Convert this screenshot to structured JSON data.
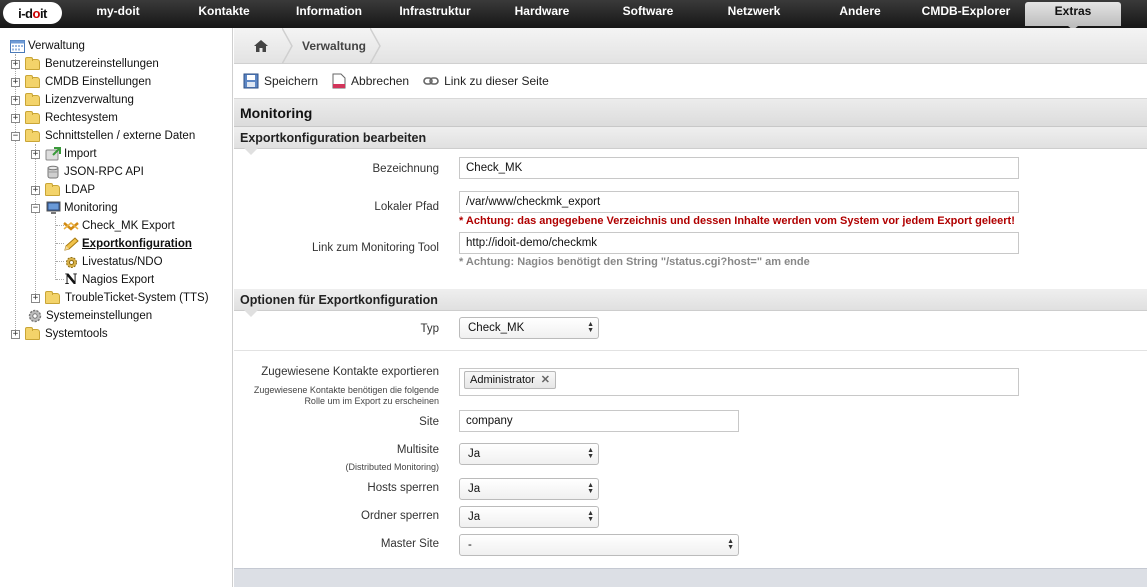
{
  "logo": {
    "part1": "i-d",
    "dot": "o",
    "part2": "it"
  },
  "nav": [
    "my-doit",
    "Kontakte",
    "Information",
    "Infrastruktur",
    "Hardware",
    "Software",
    "Netzwerk",
    "Andere",
    "CMDB-Explorer",
    "Extras"
  ],
  "nav_active": "Extras",
  "tree": {
    "root": "Verwaltung",
    "items": [
      "Benutzereinstellungen",
      "CMDB Einstellungen",
      "Lizenzverwaltung",
      "Rechtesystem",
      "Schnittstellen / externe Daten",
      "Import",
      "JSON-RPC API",
      "LDAP",
      "Monitoring",
      "Check_MK Export",
      "Exportkonfiguration",
      "Livestatus/NDO",
      "Nagios Export",
      "TroubleTicket-System (TTS)",
      "Systemeinstellungen",
      "Systemtools"
    ]
  },
  "breadcrumb": {
    "label": "Verwaltung"
  },
  "toolbar": {
    "save": "Speichern",
    "cancel": "Abbrechen",
    "link": "Link zu dieser Seite"
  },
  "page_title": "Monitoring",
  "section1": {
    "title": "Exportkonfiguration bearbeiten",
    "bezeichnung_label": "Bezeichnung",
    "bezeichnung_value": "Check_MK",
    "pfad_label": "Lokaler Pfad",
    "pfad_value": "/var/www/checkmk_export",
    "pfad_warning": "* Achtung: das angegebene Verzeichnis und dessen Inhalte werden vom System vor jedem Export geleert!",
    "link_label": "Link zum Monitoring Tool",
    "link_value": "http://idoit-demo/checkmk",
    "link_hint": "* Achtung: Nagios benötigt den String \"/status.cgi?host=\" am ende"
  },
  "section2": {
    "title": "Optionen für Exportkonfiguration",
    "typ_label": "Typ",
    "typ_value": "Check_MK",
    "kontakte_label": "Zugewiesene Kontakte exportieren",
    "kontakte_sublabel_1": "Zugewiesene Kontakte benötigen die folgende",
    "kontakte_sublabel_2": "Rolle um im Export zu erscheinen",
    "kontakte_tag": "Administrator",
    "site_label": "Site",
    "site_value": "company",
    "multisite_label": "Multisite",
    "multisite_sublabel": "(Distributed Monitoring)",
    "multisite_value": "Ja",
    "hosts_label": "Hosts sperren",
    "hosts_value": "Ja",
    "ordner_label": "Ordner sperren",
    "ordner_value": "Ja",
    "master_label": "Master Site",
    "master_value": "-"
  }
}
